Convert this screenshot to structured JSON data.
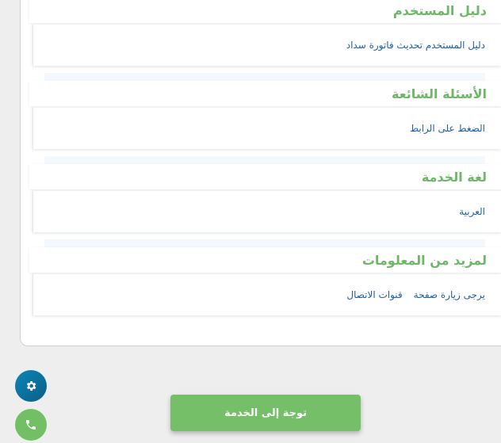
{
  "sections": [
    {
      "title": "دليل المستخدم",
      "links": [
        "دليل المستخدم تحديث فاتورة سداد"
      ]
    },
    {
      "title": "الأسئلة الشائعة",
      "links": [
        "الضغط على الرابط"
      ]
    },
    {
      "title": "لغة الخدمة",
      "links": [
        "العربية"
      ]
    },
    {
      "title": "لمزيد من المعلومات",
      "links": [
        "يرجى زيارة صفحة",
        "قنوات الاتصال"
      ]
    }
  ],
  "fabs": {
    "settings_icon": "gear-icon",
    "phone_icon": "phone-icon"
  },
  "cta": {
    "label": "توجة إلى الخدمة"
  },
  "colors": {
    "accent_green": "#74bf67",
    "link_blue": "#1f5fa8",
    "fab_blue": "#0b6f9e"
  }
}
